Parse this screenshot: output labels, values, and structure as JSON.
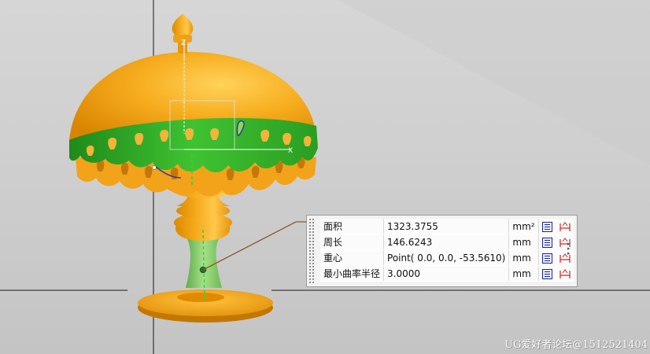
{
  "measure_panel": {
    "rows": [
      {
        "label": "面积",
        "value": "1323.3755",
        "unit": "mm²"
      },
      {
        "label": "周长",
        "value": "146.6243",
        "unit": "mm"
      },
      {
        "label": "重心",
        "value": "Point( 0.0, 0.0, -53.5610)",
        "unit": "mm"
      },
      {
        "label": "最小曲率半径",
        "value": "3.0000",
        "unit": "mm"
      }
    ],
    "row_icons": [
      "calculator-icon",
      "dimension-icon"
    ],
    "expand_arrows": [
      "▸",
      "▸",
      "▸"
    ]
  },
  "axes": {
    "z_label": "Z",
    "x_label": "X"
  },
  "colors": {
    "background": "#d0d0d0",
    "model_orange": "#f5a81a",
    "band_green": "#3ab82e",
    "selected_green": "#8ed46e",
    "leader": "#8a5a2e",
    "calc_icon": "#1a2a8a",
    "dim_icon": "#cc2222"
  },
  "watermark": "UG爱好者论坛@1512521404"
}
